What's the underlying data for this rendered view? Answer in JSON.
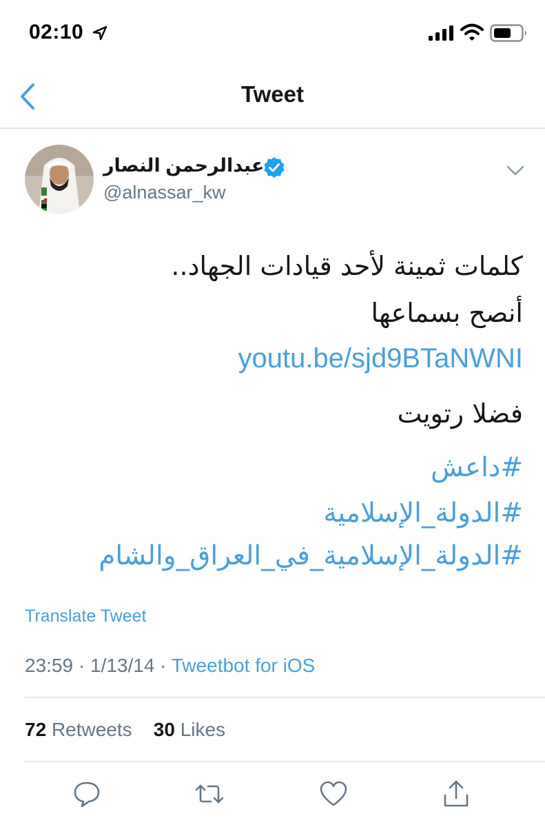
{
  "status_bar": {
    "time": "02:10",
    "icons": [
      "location-arrow-icon",
      "signal-bars-icon",
      "wifi-icon",
      "battery-icon"
    ]
  },
  "nav": {
    "title": "Tweet",
    "back_icon": "chevron-left-icon"
  },
  "tweet": {
    "author": {
      "display_name": "عبدالرحمن النصار",
      "handle": "@alnassar_kw",
      "verified": true
    },
    "text_lines": [
      "كلمات ثمينة لأحد قيادات الجهاد..",
      "أنصح بسماعها"
    ],
    "link": "youtu.be/sjd9BTaNWNI",
    "text_after": "فضلا رتويت",
    "hashtags": [
      "#داعش",
      "#الدولة_الإسلامية",
      "#الدولة_الإسلامية_في_العراق_والشام"
    ],
    "translate_label": "Translate Tweet",
    "time": "23:59",
    "date": "1/13/14",
    "source": "Tweetbot for iOS"
  },
  "stats": {
    "retweets_count": "72",
    "retweets_label": "Retweets",
    "likes_count": "30",
    "likes_label": "Likes"
  },
  "actions": [
    "reply-icon",
    "retweet-icon",
    "like-icon",
    "share-icon"
  ],
  "colors": {
    "accent": "#4a9fda",
    "text": "#14171a",
    "secondary": "#657786",
    "divider": "#e1e8ed",
    "verified": "#1da1f2"
  }
}
